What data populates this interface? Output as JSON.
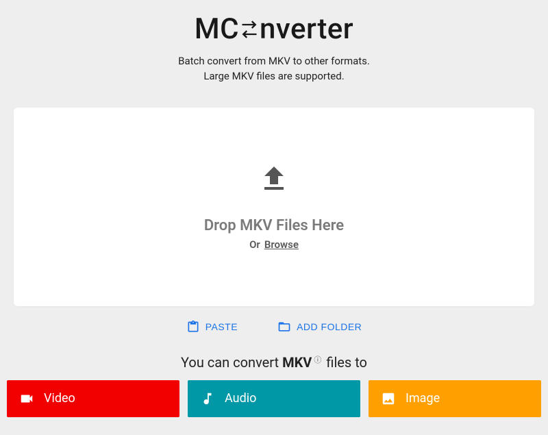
{
  "brand": {
    "prefix": "MC",
    "suffix": "nverter"
  },
  "subtitle": {
    "line1": "Batch convert from MKV to other formats.",
    "line2": "Large MKV files are supported."
  },
  "dropzone": {
    "title": "Drop MKV Files Here",
    "or": "Or",
    "browse": "Browse"
  },
  "actions": {
    "paste": "PASTE",
    "addFolder": "ADD FOLDER"
  },
  "convert": {
    "prefix": "You can convert",
    "format": "MKV",
    "suffix": "files to"
  },
  "tabs": {
    "video": "Video",
    "audio": "Audio",
    "image": "Image"
  }
}
